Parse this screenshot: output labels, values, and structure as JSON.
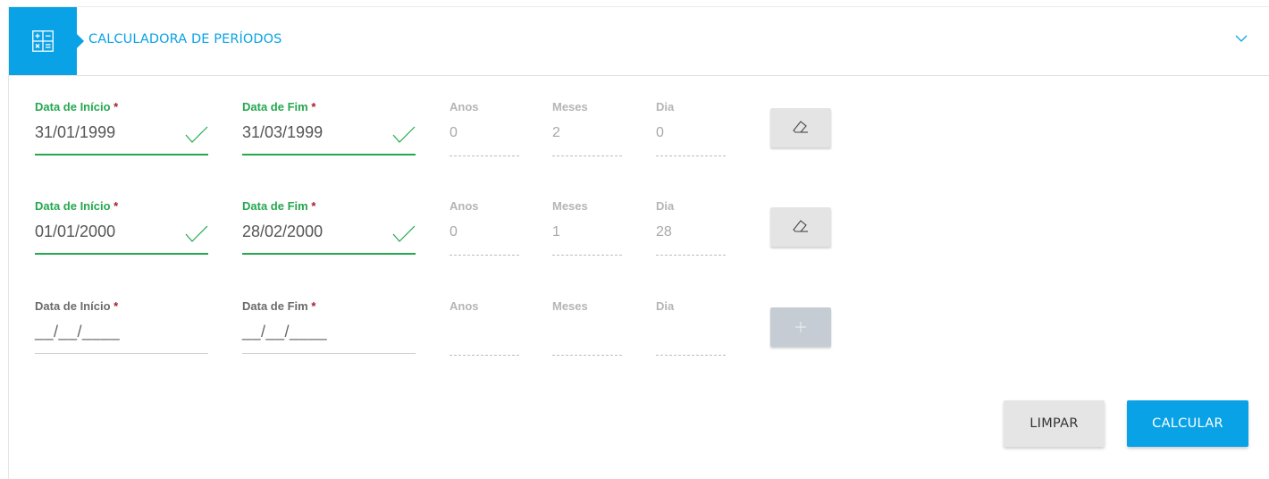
{
  "header": {
    "title": "CALCULADORA DE PERÍODOS",
    "icon": "calculator-icon",
    "toggle_icon": "chevron-down-icon",
    "accent_color": "#0aa2e6"
  },
  "labels": {
    "start": "Data de Início",
    "end": "Data de Fim",
    "required_mark": "*",
    "years": "Anos",
    "months": "Meses",
    "days": "Dia"
  },
  "rows": [
    {
      "start": "31/01/1999",
      "end": "31/03/1999",
      "years": "0",
      "months": "2",
      "days": "0",
      "valid": true,
      "action_icon": "eraser-icon"
    },
    {
      "start": "01/01/2000",
      "end": "28/02/2000",
      "years": "0",
      "months": "1",
      "days": "28",
      "valid": true,
      "action_icon": "eraser-icon"
    },
    {
      "start_placeholder": "__/__/____",
      "end_placeholder": "__/__/____",
      "years": "",
      "months": "",
      "days": "",
      "valid": false,
      "action_icon": "plus-icon"
    }
  ],
  "buttons": {
    "clear": "LIMPAR",
    "calculate": "CALCULAR"
  },
  "colors": {
    "valid": "#25a84e",
    "required": "#a51d2d"
  }
}
